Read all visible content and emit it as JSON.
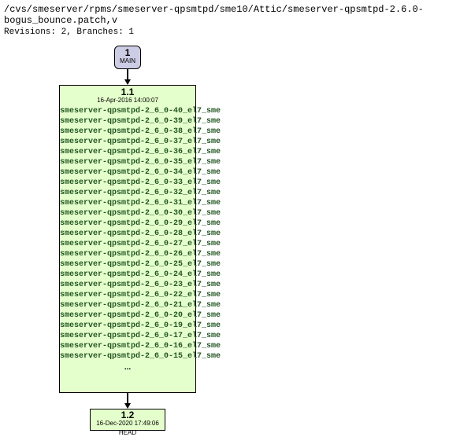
{
  "header": {
    "path": "/cvs/smeserver/rpms/smeserver-qpsmtpd/sme10/Attic/smeserver-qpsmtpd-2.6.0-bogus_bounce.patch,v",
    "revisions_branches": "Revisions: 2, Branches: 1"
  },
  "nodes": {
    "main": {
      "number": "1",
      "label": "MAIN"
    },
    "v11": {
      "version": "1.1",
      "date": "16-Apr-2016 14:00:07",
      "tags": [
        "smeserver-qpsmtpd-2_6_0-40_el7_sme",
        "smeserver-qpsmtpd-2_6_0-39_el7_sme",
        "smeserver-qpsmtpd-2_6_0-38_el7_sme",
        "smeserver-qpsmtpd-2_6_0-37_el7_sme",
        "smeserver-qpsmtpd-2_6_0-36_el7_sme",
        "smeserver-qpsmtpd-2_6_0-35_el7_sme",
        "smeserver-qpsmtpd-2_6_0-34_el7_sme",
        "smeserver-qpsmtpd-2_6_0-33_el7_sme",
        "smeserver-qpsmtpd-2_6_0-32_el7_sme",
        "smeserver-qpsmtpd-2_6_0-31_el7_sme",
        "smeserver-qpsmtpd-2_6_0-30_el7_sme",
        "smeserver-qpsmtpd-2_6_0-29_el7_sme",
        "smeserver-qpsmtpd-2_6_0-28_el7_sme",
        "smeserver-qpsmtpd-2_6_0-27_el7_sme",
        "smeserver-qpsmtpd-2_6_0-26_el7_sme",
        "smeserver-qpsmtpd-2_6_0-25_el7_sme",
        "smeserver-qpsmtpd-2_6_0-24_el7_sme",
        "smeserver-qpsmtpd-2_6_0-23_el7_sme",
        "smeserver-qpsmtpd-2_6_0-22_el7_sme",
        "smeserver-qpsmtpd-2_6_0-21_el7_sme",
        "smeserver-qpsmtpd-2_6_0-20_el7_sme",
        "smeserver-qpsmtpd-2_6_0-19_el7_sme",
        "smeserver-qpsmtpd-2_6_0-17_el7_sme",
        "smeserver-qpsmtpd-2_6_0-16_el7_sme",
        "smeserver-qpsmtpd-2_6_0-15_el7_sme"
      ],
      "ellipsis": "..."
    },
    "v12": {
      "version": "1.2",
      "date": "16-Dec-2020 17:49:06",
      "label": "HEAD"
    }
  }
}
